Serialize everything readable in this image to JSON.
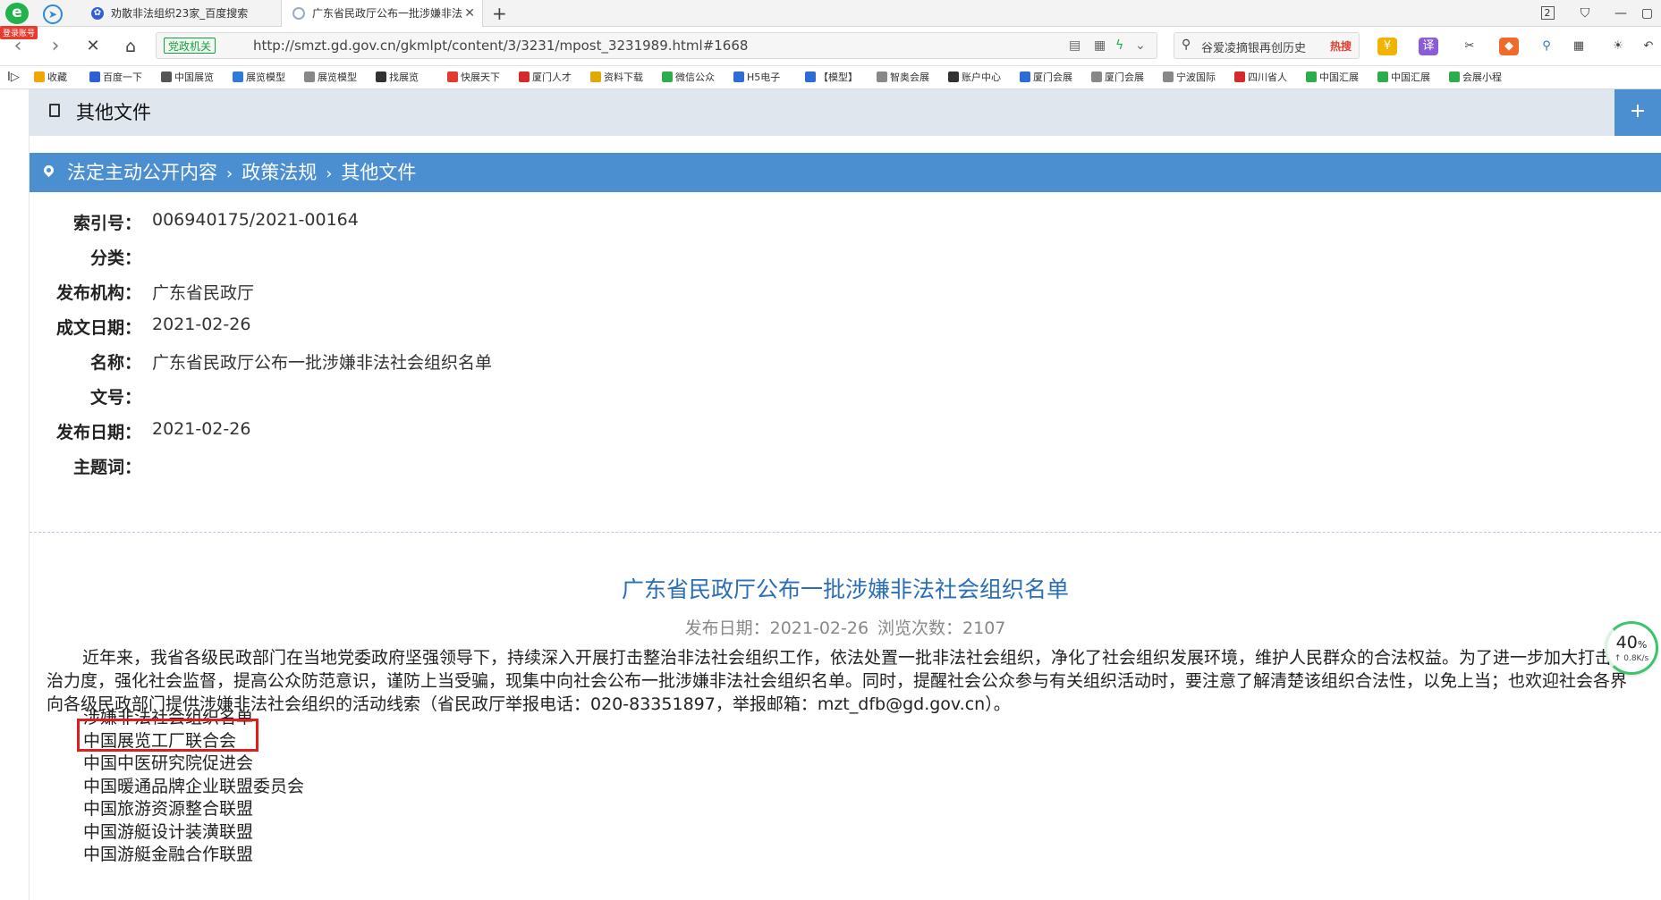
{
  "browser": {
    "login_badge": "登录账号",
    "tabs": [
      {
        "title": "劝散非法组织23家_百度搜索",
        "active": false
      },
      {
        "title": "广东省民政厅公布一批涉嫌非法",
        "active": true
      }
    ],
    "page_number_badge": "2",
    "address": {
      "site_tag": "党政机关",
      "url": "http://smzt.gd.gov.cn/gkmlpt/content/3/3231/mpost_3231989.html#1668"
    },
    "search": {
      "text": "谷爱凌摘银再创历史",
      "hot_label": "热搜"
    },
    "bookmarks": [
      {
        "label": "收藏",
        "icon": "star-icon",
        "color": "#f0a800"
      },
      {
        "label": "百度一下",
        "icon": "paw-icon",
        "color": "#2f5fd6"
      },
      {
        "label": "中国展览",
        "icon": "globe-icon",
        "color": "#555555"
      },
      {
        "label": "展览模型",
        "icon": "shield-icon",
        "color": "#2e7bd6"
      },
      {
        "label": "展览模型",
        "icon": "page-icon",
        "color": "#888888"
      },
      {
        "label": "找展览",
        "icon": "fire-icon",
        "color": "#333333"
      },
      {
        "label": "快展天下",
        "icon": "badge-icon",
        "color": "#e23a2e"
      },
      {
        "label": "厦门人才",
        "icon": "badge-icon",
        "color": "#d62a2a"
      },
      {
        "label": "资料下载",
        "icon": "circle-icon",
        "color": "#e0a800"
      },
      {
        "label": "微信公众",
        "icon": "wechat-icon",
        "color": "#2cae4b"
      },
      {
        "label": "H5电子",
        "icon": "loop-icon",
        "color": "#2e6bd6"
      },
      {
        "label": "【模型】",
        "icon": "globe-icon",
        "color": "#2e6bd6"
      },
      {
        "label": "智奥会展",
        "icon": "page-icon",
        "color": "#888888"
      },
      {
        "label": "账户中心",
        "icon": "plane-icon",
        "color": "#333333"
      },
      {
        "label": "厦门会展",
        "icon": "badge-icon",
        "color": "#2e6bd6"
      },
      {
        "label": "厦门会展",
        "icon": "page-icon",
        "color": "#888888"
      },
      {
        "label": "宁波国际",
        "icon": "page-icon",
        "color": "#888888"
      },
      {
        "label": "四川省人",
        "icon": "badge-icon",
        "color": "#d62a2a"
      },
      {
        "label": "中国汇展",
        "icon": "vee-icon",
        "color": "#2cae4b"
      },
      {
        "label": "中国汇展",
        "icon": "vee-icon",
        "color": "#2cae4b"
      },
      {
        "label": "会展小程",
        "icon": "vee-icon",
        "color": "#2cae4b"
      }
    ]
  },
  "page": {
    "header_title": "其他文件",
    "breadcrumb": [
      "法定主动公开内容",
      "政策法规",
      "其他文件"
    ],
    "meta": [
      {
        "key": "索引号：",
        "value": "006940175/2021-00164"
      },
      {
        "key": "分类：",
        "value": ""
      },
      {
        "key": "发布机构：",
        "value": "广东省民政厅"
      },
      {
        "key": "成文日期：",
        "value": "2021-02-26"
      },
      {
        "key": "名称：",
        "value": "广东省民政厅公布一批涉嫌非法社会组织名单"
      },
      {
        "key": "文号：",
        "value": ""
      },
      {
        "key": "发布日期：",
        "value": "2021-02-26"
      },
      {
        "key": "主题词：",
        "value": ""
      }
    ],
    "article": {
      "title": "广东省民政厅公布一批涉嫌非法社会组织名单",
      "publish_label": "发布日期：2021-02-26",
      "views_label": "浏览次数：2107",
      "paragraph": "近年来，我省各级民政部门在当地党委政府坚强领导下，持续深入开展打击整治非法社会组织工作，依法处置一批非法社会组织，净化了社会组织发展环境，维护人民群众的合法权益。为了进一步加大打击整治力度，强化社会监督，提高公众防范意识，谨防上当受骗，现集中向社会公布一批涉嫌非法社会组织名单。同时，提醒社会公众参与有关组织活动时，要注意了解清楚该组织合法性，以免上当；也欢迎社会各界向各级民政部门提供涉嫌非法社会组织的活动线索（省民政厅举报电话：020-83351897，举报邮箱：mzt_dfb@gd.gov.cn）。",
      "list_heading": "涉嫌非法社会组织名单",
      "organizations": [
        "中国展览工厂联合会",
        "中国中医研究院促进会",
        "中国暖通品牌企业联盟委员会",
        "中国旅游资源整合联盟",
        "中国游艇设计装潢联盟",
        "中国游艇金融合作联盟"
      ]
    },
    "speed_widget": {
      "percent": "40",
      "percent_unit": "%",
      "rate": "↑ 0.8K/s"
    }
  }
}
